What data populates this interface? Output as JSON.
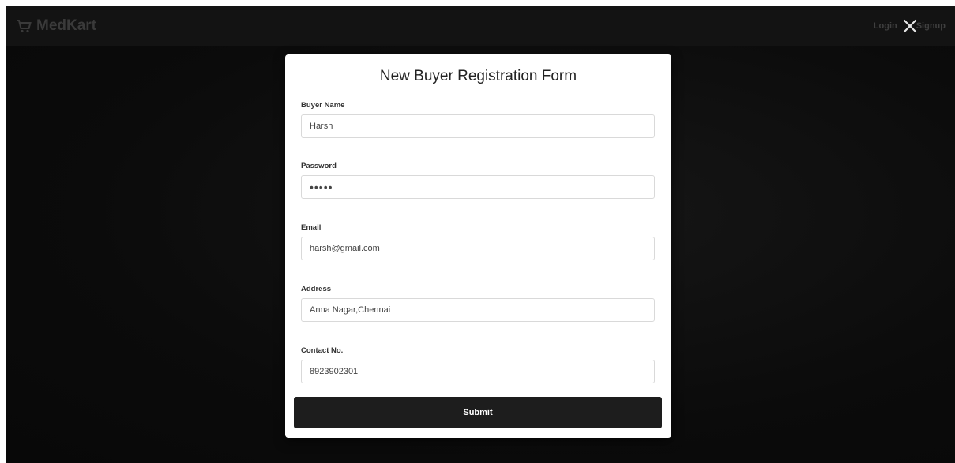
{
  "navbar": {
    "brand": "MedKart",
    "brand_icon": "cart-icon",
    "login": "Login",
    "signup": "Signup"
  },
  "modal": {
    "title": "New Buyer Registration Form",
    "fields": [
      {
        "label": "Buyer Name",
        "value": "Harsh",
        "type": "text"
      },
      {
        "label": "Password",
        "value": "•••••",
        "type": "password"
      },
      {
        "label": "Email",
        "value": "harsh@gmail.com",
        "type": "text"
      },
      {
        "label": "Address",
        "value": "Anna Nagar,Chennai",
        "type": "text"
      },
      {
        "label": "Contact No.",
        "value": "8923902301",
        "type": "text"
      }
    ],
    "submit_label": "Submit"
  },
  "colors": {
    "background": "#0b0b0b",
    "button": "#1d1d1d",
    "modal": "#ffffff"
  }
}
